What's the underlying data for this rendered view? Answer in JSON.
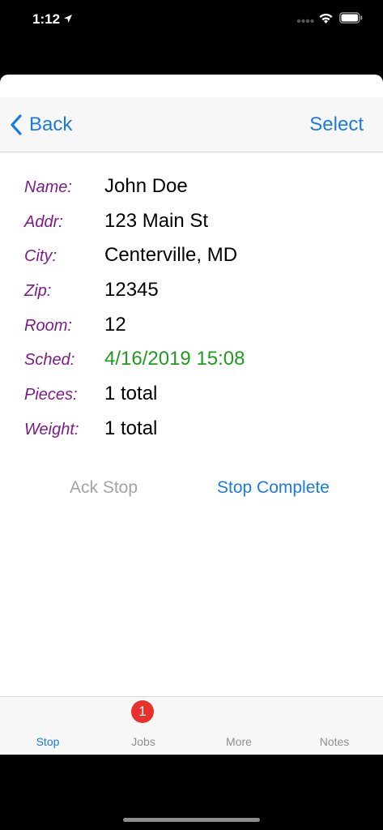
{
  "status_bar": {
    "time": "1:12",
    "location_icon": "location-arrow-icon",
    "signal_icon": "cellular-signal-icon",
    "wifi_icon": "wifi-icon",
    "battery_icon": "battery-icon"
  },
  "nav": {
    "back_label": "Back",
    "select_label": "Select",
    "accent_color": "#1a7ce3"
  },
  "details": [
    {
      "label": "Name:",
      "value": "John Doe"
    },
    {
      "label": "Addr:",
      "value": "123 Main St"
    },
    {
      "label": "City:",
      "value": "Centerville, MD"
    },
    {
      "label": "Zip:",
      "value": "12345"
    },
    {
      "label": "Room:",
      "value": "12"
    },
    {
      "label": "Sched:",
      "value": "4/16/2019 15:08"
    },
    {
      "label": "Pieces:",
      "value": "1 total"
    },
    {
      "label": "Weight:",
      "value": "1 total"
    }
  ],
  "colors": {
    "label": "#7d1b8a",
    "sched_value": "#1f9c1f",
    "disabled": "#a3a3a3",
    "badge": "#e8312a"
  },
  "actions": {
    "ack_label": "Ack Stop",
    "complete_label": "Stop Complete"
  },
  "tabs": [
    {
      "label": "Stop",
      "active": true
    },
    {
      "label": "Jobs",
      "badge": "1"
    },
    {
      "label": "More"
    },
    {
      "label": "Notes"
    }
  ]
}
